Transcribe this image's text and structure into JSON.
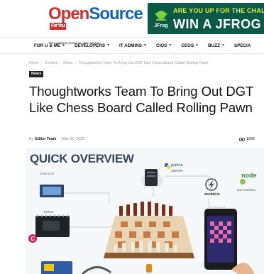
{
  "site": {
    "logo_open": "Open",
    "logo_source": "Source",
    "logo_badge": "For You",
    "tagline": "The complete portal on open source"
  },
  "ad": {
    "brand": "JFrog",
    "line1": "ARE YOU UP FOR THE CHALLENGE?",
    "line2": "WIN A JFROG T-S",
    "colors": {
      "bg": "#0c5a46",
      "accent": "#d6f03a"
    }
  },
  "nav": {
    "items": [
      {
        "label": "FOR U & ME"
      },
      {
        "label": "DEVELOPERS"
      },
      {
        "label": "IT ADMINS"
      },
      {
        "label": "CIOS"
      },
      {
        "label": "CEOS"
      },
      {
        "label": "BUZZ"
      },
      {
        "label": "SPECIA"
      }
    ]
  },
  "breadcrumb": [
    "Home",
    "Content",
    "News",
    "Thoughtworks Team To Bring Out DGT Like Chess Board Called Rolling Pawn"
  ],
  "category": "News",
  "article": {
    "title": "Thoughtworks Team To Bring Out DGT Like Chess Board Called Rolling Pawn",
    "by": "By",
    "author": "Editor Team",
    "date": "May 20, 2020",
    "views": "1096"
  },
  "hero": {
    "heading": "QUICK OVERVIEW",
    "labels": {
      "snow_lcd": "Snow LCD",
      "esp32": "ESP32",
      "python": "python",
      "server": "SERVER",
      "socketio": "socket.io",
      "nodejs": "node",
      "user_interface": "User Interface",
      "board_caption": "ROLLING PAWNS CHESS"
    }
  }
}
